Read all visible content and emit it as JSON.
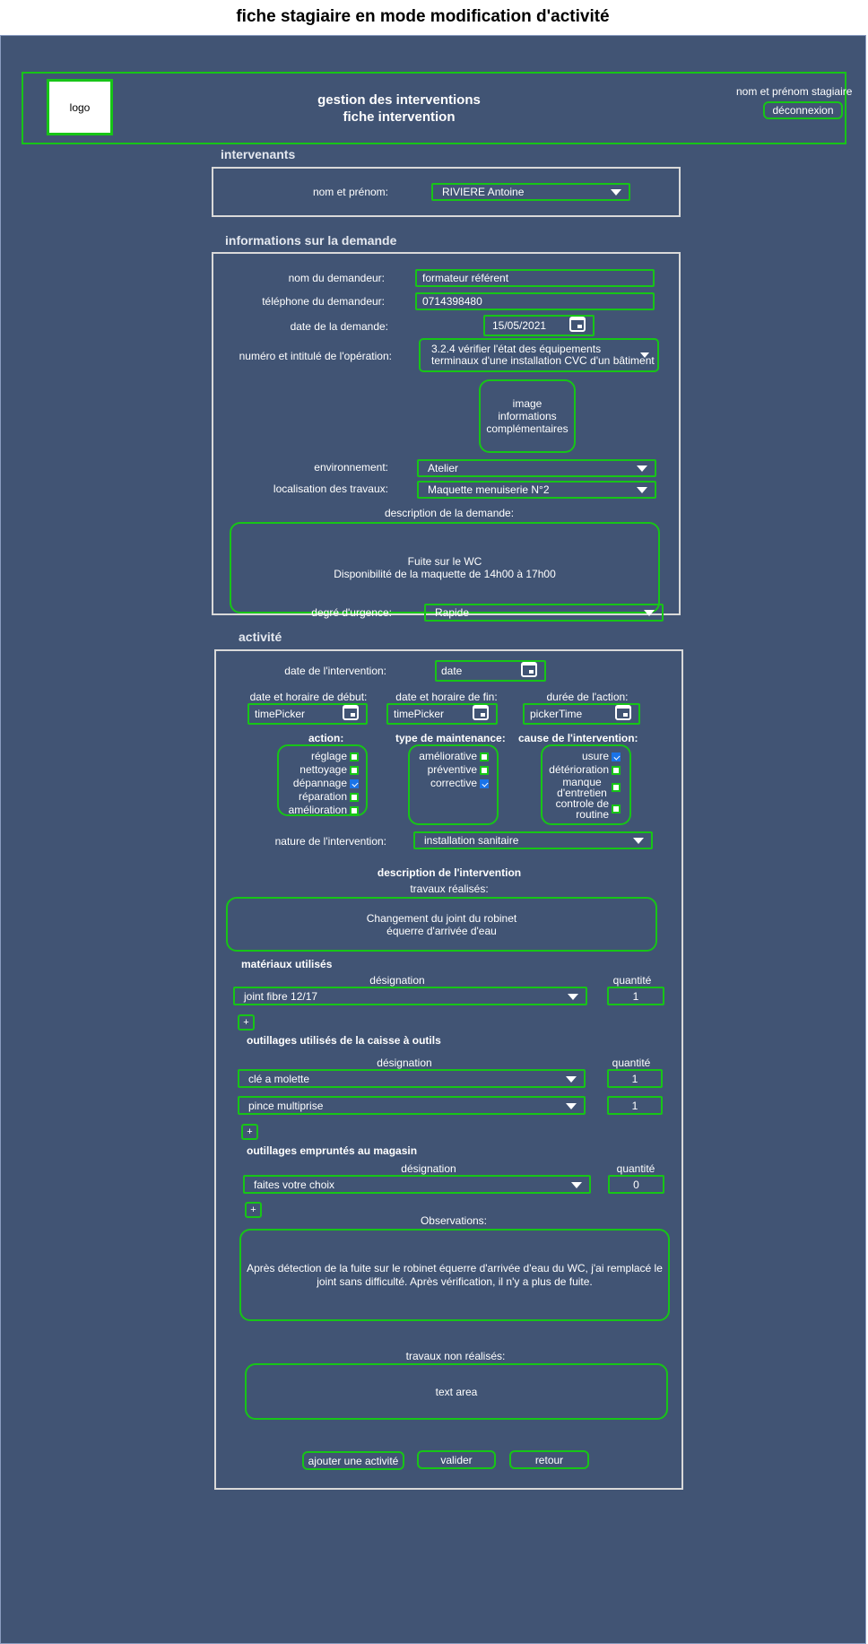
{
  "page_title": "fiche stagiaire en mode modification d'activité",
  "header": {
    "logo": "logo",
    "title_line1": "gestion des interventions",
    "title_line2": "fiche intervention",
    "user": "nom et prénom stagiaire",
    "logout": "déconnexion"
  },
  "intervenants": {
    "section": "intervenants",
    "name_label": "nom et prénom:",
    "name_value": "RIVIERE Antoine"
  },
  "demande": {
    "section": "informations sur la demande",
    "requester_label": "nom du demandeur:",
    "requester_value": "formateur référent",
    "phone_label": "téléphone du demandeur:",
    "phone_value": "0714398480",
    "date_label": "date de la demande:",
    "date_value": "15/05/2021",
    "operation_label": "numéro et intitulé de l'opération:",
    "operation_line1": "3.2.4 vérifier l'état des équipements",
    "operation_line2": "terminaux d'une installation CVC d'un bâtiment",
    "image_line1": "image",
    "image_line2": "informations",
    "image_line3": "complémentaires",
    "env_label": "environnement:",
    "env_value": "Atelier",
    "loc_label": "localisation des travaux:",
    "loc_value": "Maquette menuiserie N°2",
    "desc_label": "description de la demande:",
    "desc_line1": "Fuite sur le WC",
    "desc_line2": "Disponibilité de la maquette de 14h00 à 17h00",
    "urgency_label": "degré d'urgence:",
    "urgency_value": "Rapide"
  },
  "activite": {
    "section": "activité",
    "date_label": "date de l'intervention:",
    "date_value": "date",
    "start_label": "date et horaire de début:",
    "start_value": "timePicker",
    "end_label": "date et horaire de fin:",
    "end_value": "timePicker",
    "duration_label": "durée de l'action:",
    "duration_value": "pickerTime",
    "action_label": "action:",
    "maintenance_label": "type de maintenance:",
    "cause_label": "cause de l'intervention:",
    "actions": [
      {
        "label": "réglage",
        "checked": false
      },
      {
        "label": "nettoyage",
        "checked": false
      },
      {
        "label": "dépannage",
        "checked": true
      },
      {
        "label": "réparation",
        "checked": false
      },
      {
        "label": "amélioration",
        "checked": false
      }
    ],
    "maintenance": [
      {
        "label": "améliorative",
        "checked": false
      },
      {
        "label": "préventive",
        "checked": false
      },
      {
        "label": "corrective",
        "checked": true
      }
    ],
    "causes": [
      {
        "label": "usure",
        "checked": true
      },
      {
        "label": "détérioration",
        "checked": false
      },
      {
        "label": "manque d'entretien",
        "checked": false
      },
      {
        "label": "controle de routine",
        "checked": false
      }
    ],
    "nature_label": "nature de l'intervention:",
    "nature_value": "installation sanitaire",
    "desc_heading": "description de l'intervention",
    "works_label": "travaux réalisés:",
    "works_line1": "Changement du joint du robinet",
    "works_line2": "équerre d'arrivée d'eau",
    "materials_heading": "matériaux utilisés",
    "designation": "désignation",
    "quantity": "quantité",
    "materials": [
      {
        "name": "joint fibre 12/17",
        "qty": "1"
      }
    ],
    "tools_heading": "outillages utilisés de la caisse à outils",
    "tools": [
      {
        "name": "clé a molette",
        "qty": "1"
      },
      {
        "name": "pince multiprise",
        "qty": "1"
      }
    ],
    "borrowed_heading": "outillages empruntés au magasin",
    "borrowed": [
      {
        "name": "faites votre choix",
        "qty": "0"
      }
    ],
    "plus": "+",
    "obs_label": "Observations:",
    "obs_text": "Après détection de la fuite sur le robinet équerre d'arrivée d'eau du WC, j'ai remplacé le joint sans difficulté. Après vérification, il n'y a plus de fuite.",
    "not_done_label": "travaux non réalisés:",
    "not_done_value": "text area"
  },
  "footer": {
    "add": "ajouter une activité",
    "validate": "valider",
    "back": "retour"
  },
  "colors": {
    "background": "#415474",
    "accent": "#17c517",
    "border": "#d9d9d9"
  }
}
